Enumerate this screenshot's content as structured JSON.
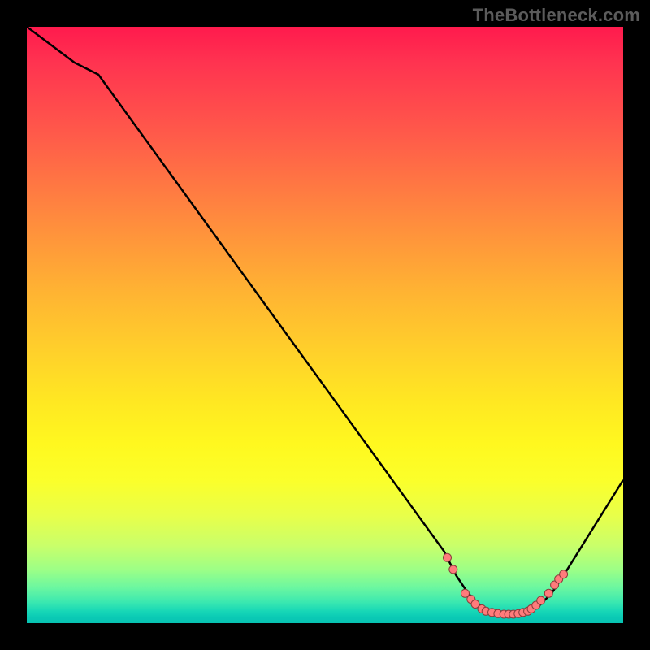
{
  "watermark": "TheBottleneck.com",
  "colors": {
    "page_bg": "#000000",
    "point_fill": "#ff7b7b",
    "point_stroke": "#8b3d3d",
    "curve_stroke": "#000000"
  },
  "chart_data": {
    "type": "line",
    "title": "",
    "xlabel": "",
    "ylabel": "",
    "xlim": [
      0,
      100
    ],
    "ylim": [
      0,
      100
    ],
    "grid": false,
    "legend": false,
    "series": [
      {
        "name": "curve",
        "x": [
          0,
          4,
          8,
          12,
          70,
          72,
          74,
          76,
          78,
          80,
          82,
          84,
          86,
          88,
          90,
          100
        ],
        "y": [
          100,
          97,
          94,
          92,
          12,
          8,
          5,
          3,
          2,
          1.5,
          1.5,
          2,
          3,
          5,
          8,
          24
        ]
      }
    ],
    "points": {
      "name": "markers",
      "x": [
        70.5,
        71.5,
        73.5,
        74.5,
        75.2,
        76.3,
        77.0,
        78.0,
        79.0,
        80.0,
        80.8,
        81.6,
        82.4,
        83.2,
        84.0,
        84.6,
        85.4,
        86.2,
        87.5,
        88.5,
        89.2,
        90.0
      ],
      "y": [
        11.0,
        9.0,
        5.0,
        4.0,
        3.2,
        2.4,
        2.0,
        1.8,
        1.6,
        1.5,
        1.5,
        1.5,
        1.6,
        1.8,
        2.0,
        2.4,
        3.0,
        3.8,
        5.0,
        6.4,
        7.4,
        8.2
      ]
    }
  }
}
